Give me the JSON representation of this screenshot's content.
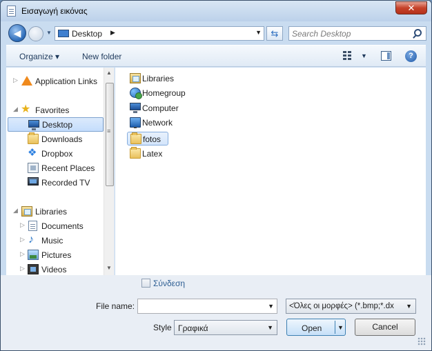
{
  "window": {
    "title": "Εισαγωγή εικόνας",
    "close_label": "✕"
  },
  "address": {
    "location": "Desktop",
    "search_placeholder": "Search Desktop"
  },
  "toolbar": {
    "organize_label": "Organize ▾",
    "new_folder_label": "New folder",
    "help_label": "?"
  },
  "navigation": [
    {
      "label": "Application Links",
      "icon": "application-links-icon",
      "expander": "▷"
    },
    {
      "label": "Favorites",
      "icon": "star-icon",
      "expander": "◢"
    },
    {
      "label": "Desktop",
      "icon": "desktop-icon",
      "selected": true
    },
    {
      "label": "Downloads",
      "icon": "downloads-icon"
    },
    {
      "label": "Dropbox",
      "icon": "dropbox-icon"
    },
    {
      "label": "Recent Places",
      "icon": "recent-places-icon"
    },
    {
      "label": "Recorded TV",
      "icon": "recorded-tv-icon"
    },
    {
      "label": "Libraries",
      "icon": "libraries-icon",
      "expander": "◢"
    },
    {
      "label": "Documents",
      "icon": "documents-icon",
      "expander": "▷"
    },
    {
      "label": "Music",
      "icon": "music-icon",
      "expander": "▷"
    },
    {
      "label": "Pictures",
      "icon": "pictures-icon",
      "expander": "▷"
    },
    {
      "label": "Videos",
      "icon": "videos-icon",
      "expander": "▷"
    }
  ],
  "content": [
    {
      "label": "Libraries",
      "icon": "libraries-icon"
    },
    {
      "label": "Homegroup",
      "icon": "homegroup-icon"
    },
    {
      "label": "Computer",
      "icon": "computer-icon"
    },
    {
      "label": "Network",
      "icon": "network-icon"
    },
    {
      "label": "fotos",
      "icon": "folder-icon",
      "selected": true
    },
    {
      "label": "Latex",
      "icon": "folder-icon"
    }
  ],
  "options": {
    "sync_label": "Σύνδεση"
  },
  "file_name": {
    "label": "File name:",
    "value": ""
  },
  "file_type": {
    "selected": "<Όλες οι μορφές> (*.bmp;*.dx"
  },
  "style": {
    "label": "Style",
    "selected": "Γραφικά"
  },
  "buttons": {
    "open_label": "Open",
    "cancel_label": "Cancel"
  },
  "colors": {
    "accent": "#3c7fb1",
    "selection": "#c4ddfc",
    "frame": "#c9dcf0"
  }
}
